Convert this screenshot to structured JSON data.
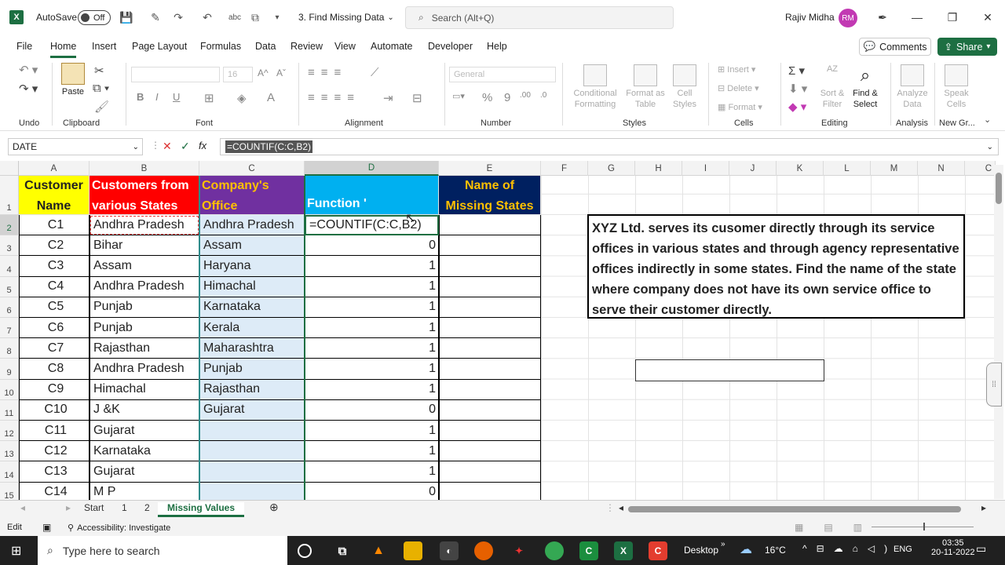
{
  "titlebar": {
    "autosave_label": "AutoSave",
    "autosave_state": "Off",
    "doc_name": "3. Find Missing Data",
    "search_placeholder": "Search (Alt+Q)",
    "user_name": "Rajiv Midha",
    "user_initials": "RM"
  },
  "menu": {
    "tabs": [
      "File",
      "Home",
      "Insert",
      "Page Layout",
      "Formulas",
      "Data",
      "Review",
      "View",
      "Automate",
      "Developer",
      "Help"
    ],
    "active": "Home",
    "comments_label": "Comments",
    "share_label": "Share"
  },
  "ribbon": {
    "groups": [
      "Undo",
      "Clipboard",
      "Font",
      "Alignment",
      "Number",
      "Styles",
      "Cells",
      "Editing",
      "Analysis",
      "New Gr..."
    ],
    "paste_label": "Paste",
    "font_size": "16",
    "number_format": "General",
    "conditional_formatting": "Conditional Formatting",
    "format_as_table": "Format as Table",
    "cell_styles": "Cell Styles",
    "insert": "Insert",
    "delete": "Delete",
    "format": "Format",
    "sort_filter": "Sort & Filter",
    "find_select": "Find & Select",
    "analyze_data": "Analyze Data",
    "speak_cells": "Speak Cells"
  },
  "formula_bar": {
    "name_box": "DATE",
    "formula": "=COUNTIF(C:C,B2)"
  },
  "grid": {
    "columns": [
      "A",
      "B",
      "C",
      "D",
      "E",
      "F",
      "G",
      "H",
      "I",
      "J",
      "K",
      "L",
      "M",
      "N",
      "C"
    ],
    "selected_column": "D",
    "rows": [
      "1",
      "2",
      "3",
      "4",
      "5",
      "6",
      "7",
      "8",
      "9",
      "10",
      "11",
      "12",
      "13",
      "14",
      "15"
    ],
    "selected_row": "2",
    "header": {
      "a": "Customer Name",
      "b": "Customers from various States",
      "c": "Company's Office",
      "d": "Function '",
      "e": "Name of Missing States"
    },
    "header_colors": {
      "a": "#ffff00",
      "b": "#ff0000",
      "c": "#7030a0",
      "d": "#00b0f0",
      "e": "#002060"
    },
    "data": [
      {
        "a": "C1",
        "b": "Andhra Pradesh",
        "c": "Andhra Pradesh",
        "d": "=COUNTIF(C:C,B2)"
      },
      {
        "a": "C2",
        "b": "Bihar",
        "c": "Assam",
        "d": "0"
      },
      {
        "a": "C3",
        "b": "Assam",
        "c": "Haryana",
        "d": "1"
      },
      {
        "a": "C4",
        "b": "Andhra Pradesh",
        "c": "Himachal",
        "d": "1"
      },
      {
        "a": "C5",
        "b": "Punjab",
        "c": "Karnataka",
        "d": "1"
      },
      {
        "a": "C6",
        "b": "Punjab",
        "c": "Kerala",
        "d": "1"
      },
      {
        "a": "C7",
        "b": "Rajasthan",
        "c": "Maharashtra",
        "d": "1"
      },
      {
        "a": "C8",
        "b": "Andhra Pradesh",
        "c": "Punjab",
        "d": "1"
      },
      {
        "a": "C9",
        "b": "Himachal",
        "c": "Rajasthan",
        "d": "1"
      },
      {
        "a": "C10",
        "b": "J &K",
        "c": "Gujarat",
        "d": "0"
      },
      {
        "a": "C11",
        "b": "Gujarat",
        "c": "",
        "d": "1"
      },
      {
        "a": "C12",
        "b": "Karnataka",
        "c": "",
        "d": "1"
      },
      {
        "a": "C13",
        "b": "Gujarat",
        "c": "",
        "d": "1"
      },
      {
        "a": "C14",
        "b": "M P",
        "c": "",
        "d": "0"
      }
    ],
    "textbox": "XYZ Ltd. serves its cusomer directly through its service offices in various states and through agency representative offices indirectly in some states. Find the name of the state where company does not have its own service office to serve their customer directly."
  },
  "sheets": {
    "tabs": [
      "Start",
      "1",
      "2",
      "Missing Values"
    ],
    "active": "Missing Values"
  },
  "status": {
    "mode": "Edit",
    "accessibility": "Accessibility: Investigate"
  },
  "taskbar": {
    "search_placeholder": "Type here to search",
    "desktop_label": "Desktop",
    "temperature": "16°C",
    "language": "ENG",
    "time": "03:35",
    "date": "20-11-2022"
  }
}
